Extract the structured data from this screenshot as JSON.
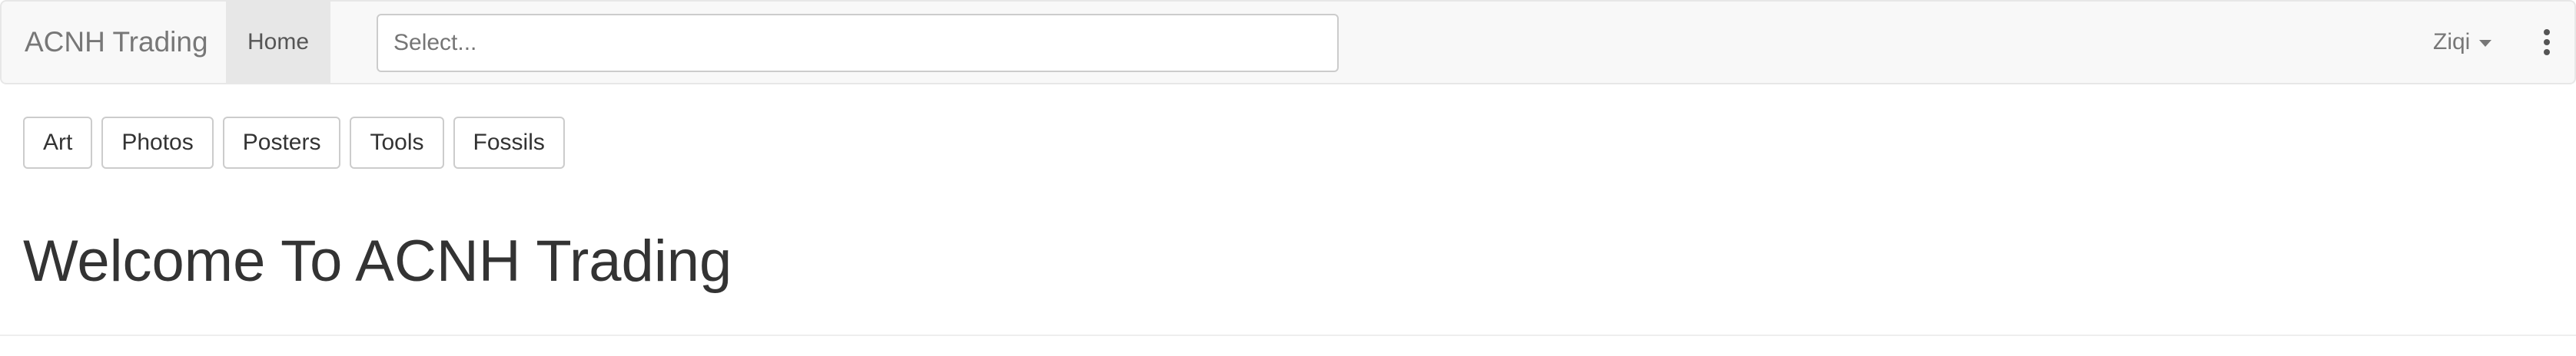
{
  "navbar": {
    "brand": "ACNH Trading",
    "home_label": "Home",
    "select_placeholder": "Select...",
    "user_name": "Ziqi",
    "menu_icon": "kebab-menu-icon",
    "user_caret_icon": "caret-down-icon"
  },
  "categories": [
    {
      "label": "Art"
    },
    {
      "label": "Photos"
    },
    {
      "label": "Posters"
    },
    {
      "label": "Tools"
    },
    {
      "label": "Fossils"
    }
  ],
  "main": {
    "heading": "Welcome To ACNH Trading"
  },
  "colors": {
    "navbar_bg": "#f8f8f8",
    "navbar_border": "#e7e7e7",
    "active_nav_bg": "#e7e7e7",
    "text_primary": "#333333",
    "text_muted": "#777777",
    "button_border": "#cccccc"
  }
}
